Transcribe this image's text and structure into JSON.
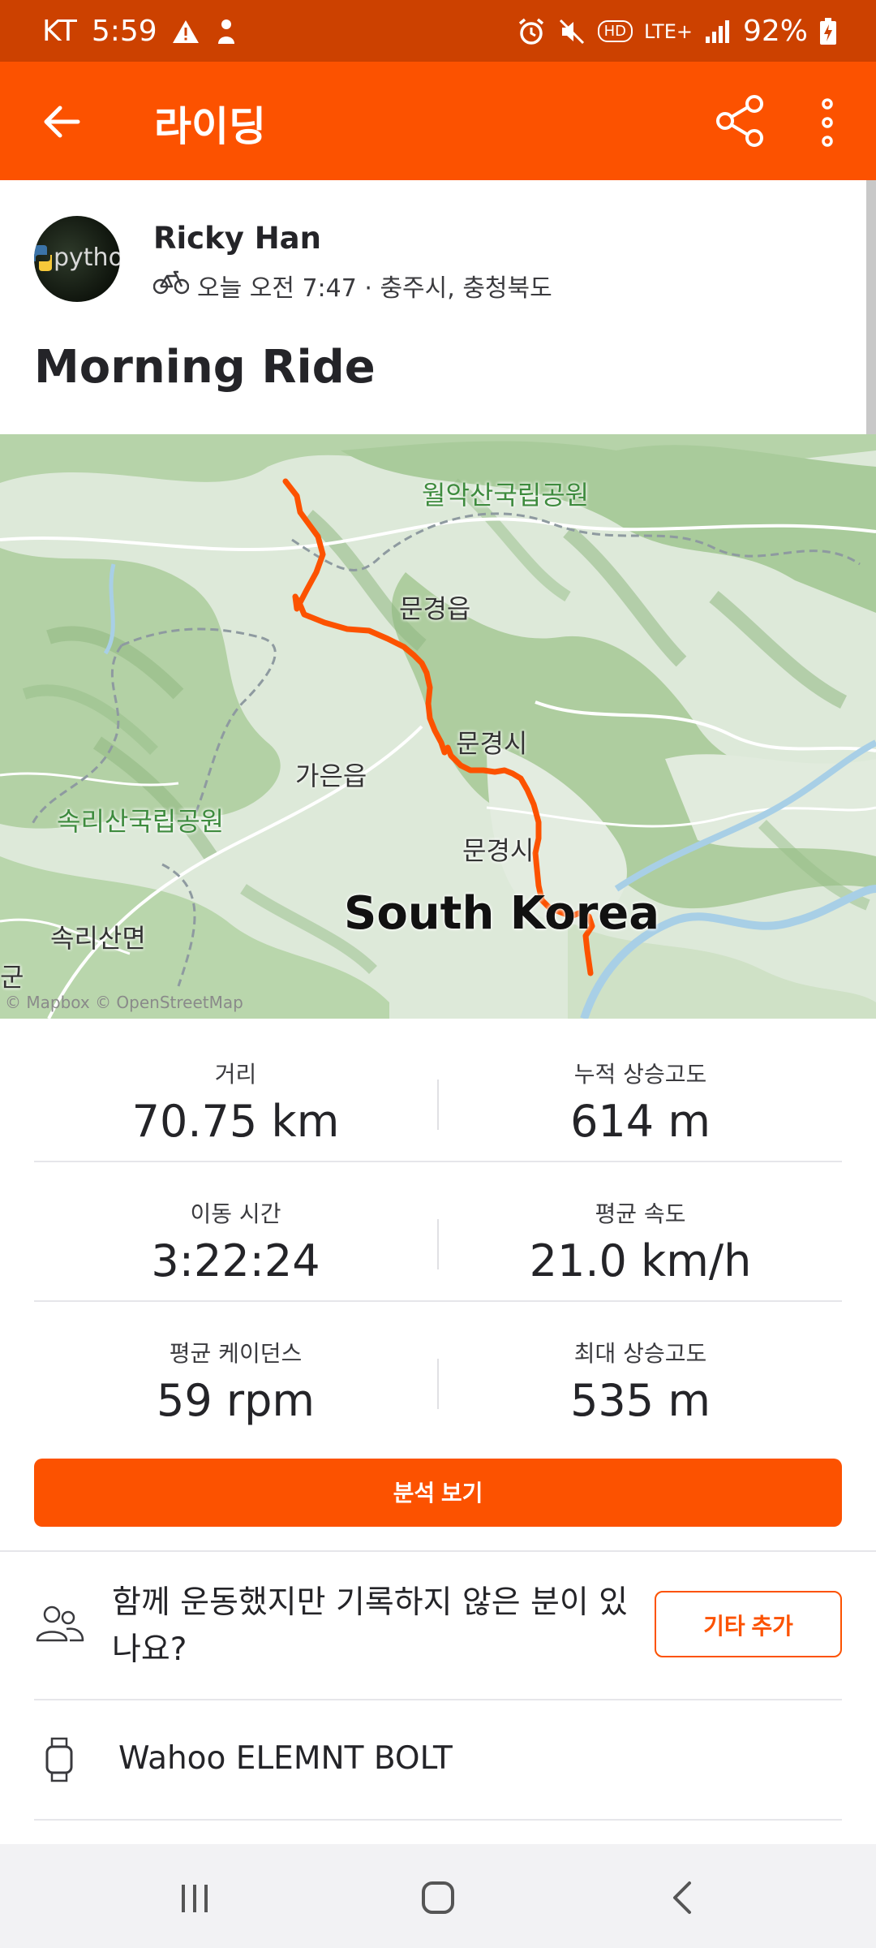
{
  "status_bar": {
    "carrier": "KT",
    "time": "5:59",
    "battery": "92%",
    "network": "LTE+",
    "hd": "HD"
  },
  "app_bar": {
    "title": "라이딩"
  },
  "athlete": {
    "name": "Ricky Han",
    "avatar_text": "python",
    "meta": "오늘 오전 7:47 · 충주시, 충청북도"
  },
  "activity": {
    "title": "Morning Ride"
  },
  "map": {
    "labels": {
      "park_north": "월악산국립공원",
      "town1": "문경읍",
      "city1": "문경시",
      "town2": "가은읍",
      "park_west": "속리산국립공원",
      "city2": "문경시",
      "district": "속리산면",
      "edge": "군",
      "country": "South Korea"
    },
    "attribution": "© Mapbox © OpenStreetMap",
    "route_color": "#fc5200"
  },
  "stats": {
    "distance": {
      "label": "거리",
      "value": "70.75 km"
    },
    "elevation_gain": {
      "label": "누적 상승고도",
      "value": "614 m"
    },
    "moving_time": {
      "label": "이동 시간",
      "value": "3:22:24"
    },
    "avg_speed": {
      "label": "평균 속도",
      "value": "21.0 km/h"
    },
    "avg_cadence": {
      "label": "평균 케이던스",
      "value": "59 rpm"
    },
    "max_elevation": {
      "label": "최대 상승고도",
      "value": "535 m"
    }
  },
  "actions": {
    "analysis_label": "분석 보기",
    "group_prompt": "함께 운동했지만 기록하지 않은 분이 있나요?",
    "add_others_label": "기타 추가"
  },
  "device": {
    "name": "Wahoo ELEMNT BOLT"
  },
  "colors": {
    "brand": "#fc5200",
    "status_bar": "#cc4100"
  }
}
